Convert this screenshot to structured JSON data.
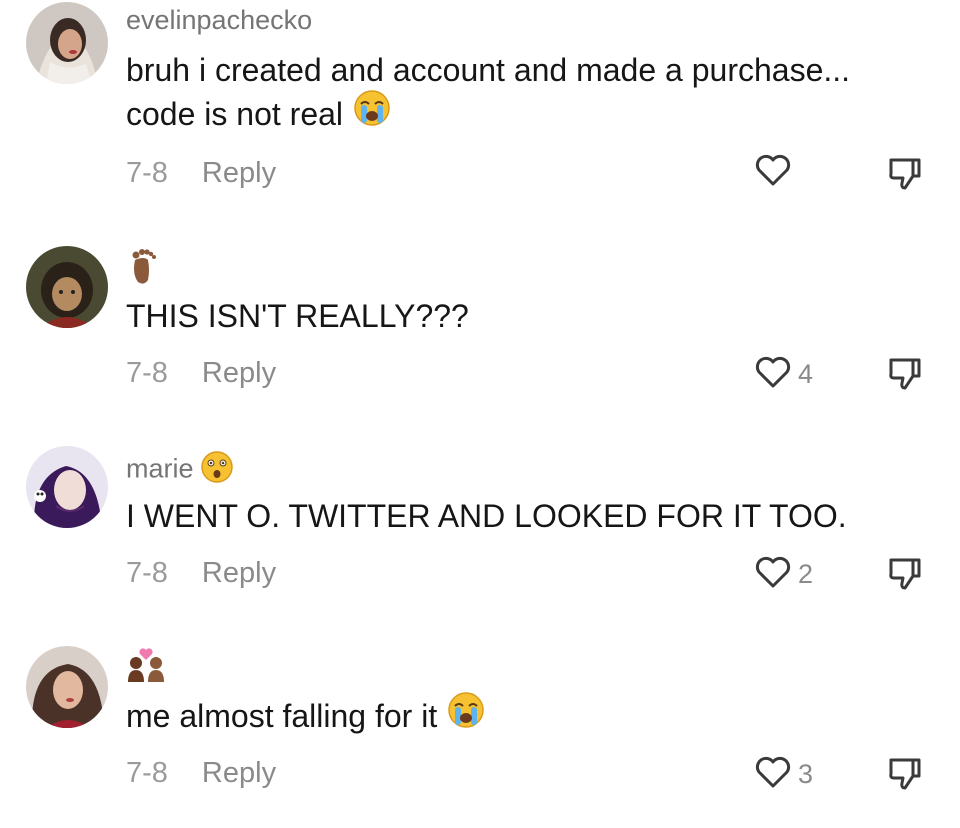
{
  "comments": [
    {
      "username": "evelinpachecko",
      "text": "bruh i created and account and made a purchase... code is not real",
      "text_line1": "bruh i created and account and made a purchase...",
      "text_line2": "code is not real",
      "text_emoji": "loudly-crying-face",
      "date": "7-8",
      "reply_label": "Reply",
      "likes": ""
    },
    {
      "username": "",
      "username_emoji": "foot-emoji",
      "text": "THIS ISN'T REALLY???",
      "date": "7-8",
      "reply_label": "Reply",
      "likes": "4"
    },
    {
      "username": "marie",
      "username_emoji": "astonished-face",
      "text": "I WENT O. TWITTER AND LOOKED FOR IT TOO.",
      "date": "7-8",
      "reply_label": "Reply",
      "likes": "2"
    },
    {
      "username": "",
      "username_emoji": "couple-with-heart-emoji",
      "text": "me almost falling for it",
      "text_emoji": "loudly-crying-face",
      "date": "7-8",
      "reply_label": "Reply",
      "likes": "3"
    }
  ],
  "colors": {
    "text": "#161616",
    "muted": "#8a8a8a",
    "date": "#9b9b9b",
    "icon": "#3a3a3a"
  }
}
